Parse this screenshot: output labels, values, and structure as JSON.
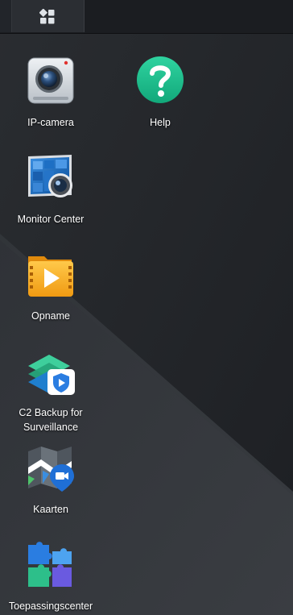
{
  "taskbar": {
    "main_menu_icon": "grid-icon"
  },
  "desktop": {
    "shortcuts": [
      {
        "label": "IP-camera",
        "icon": "ip-camera-icon"
      },
      {
        "label": "Help",
        "icon": "help-icon"
      },
      {
        "label": "Monitor Center",
        "icon": "monitor-center-icon"
      },
      {
        "label": "Opname",
        "icon": "recording-icon"
      },
      {
        "label": "C2 Backup for Surveillance",
        "icon": "c2-backup-icon"
      },
      {
        "label": "Kaarten",
        "icon": "map-icon"
      },
      {
        "label": "Toepassingscenter",
        "icon": "application-center-icon"
      }
    ]
  },
  "colors": {
    "desktop_background": "#1e2024",
    "taskbar_background": "#1b1d21",
    "help_green": "#1fbf8f",
    "opname_orange": "#f5a623"
  }
}
